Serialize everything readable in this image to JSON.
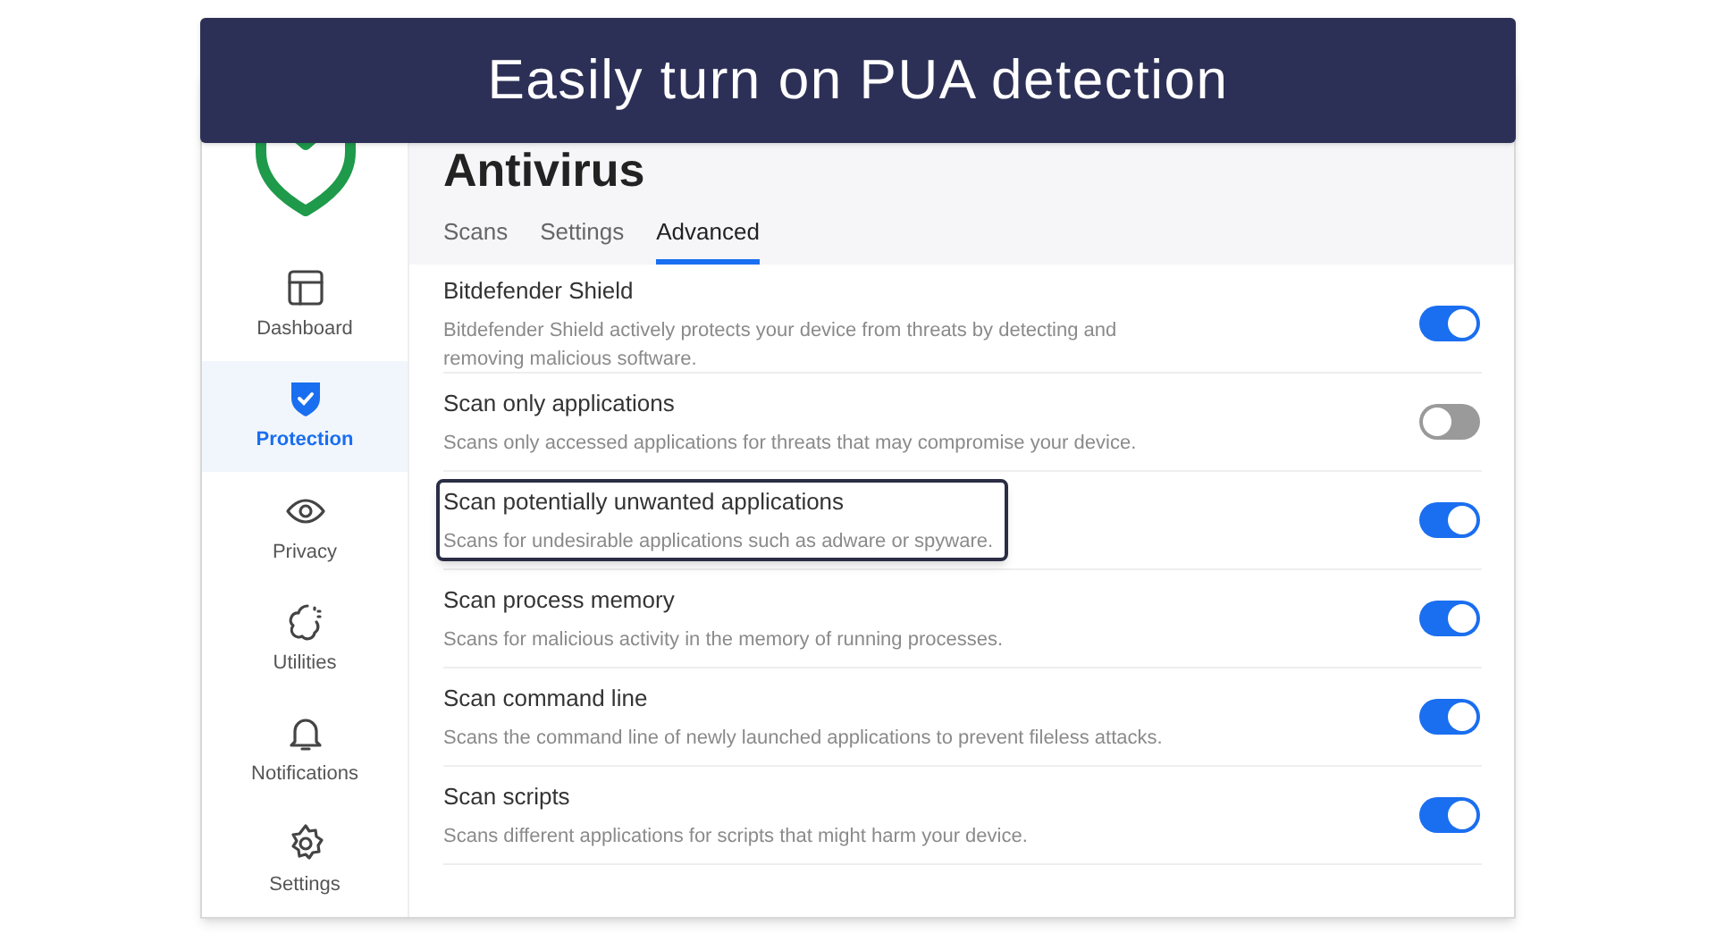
{
  "banner": {
    "title": "Easily turn on PUA detection"
  },
  "sidebar": {
    "items": [
      {
        "kind": "dashboard",
        "label": "Dashboard",
        "selected": false
      },
      {
        "kind": "protection",
        "label": "Protection",
        "selected": true
      },
      {
        "kind": "privacy",
        "label": "Privacy",
        "selected": false
      },
      {
        "kind": "utilities",
        "label": "Utilities",
        "selected": false
      },
      {
        "kind": "notifications",
        "label": "Notifications",
        "selected": false
      },
      {
        "kind": "settings",
        "label": "Settings",
        "selected": false
      }
    ]
  },
  "page": {
    "title": "Antivirus",
    "tabs": [
      {
        "label": "Scans",
        "selected": false
      },
      {
        "label": "Settings",
        "selected": false
      },
      {
        "label": "Advanced",
        "selected": true
      }
    ]
  },
  "settings": [
    {
      "title": "Bitdefender Shield",
      "description": "Bitdefender Shield actively protects your device from threats by detecting and removing malicious software.",
      "on": true,
      "highlighted": false
    },
    {
      "title": "Scan only applications",
      "description": "Scans only accessed applications for threats that may compromise your device.",
      "on": false,
      "highlighted": false
    },
    {
      "title": "Scan potentially unwanted applications",
      "description": "Scans for undesirable applications such as adware or spyware.",
      "on": true,
      "highlighted": true
    },
    {
      "title": "Scan process memory",
      "description": "Scans for malicious activity in the memory of running processes.",
      "on": true,
      "highlighted": false
    },
    {
      "title": "Scan command line",
      "description": "Scans the command line of newly launched applications to prevent fileless attacks.",
      "on": true,
      "highlighted": false
    },
    {
      "title": "Scan scripts",
      "description": "Scans different applications for scripts that might harm your device.",
      "on": true,
      "highlighted": false
    }
  ]
}
